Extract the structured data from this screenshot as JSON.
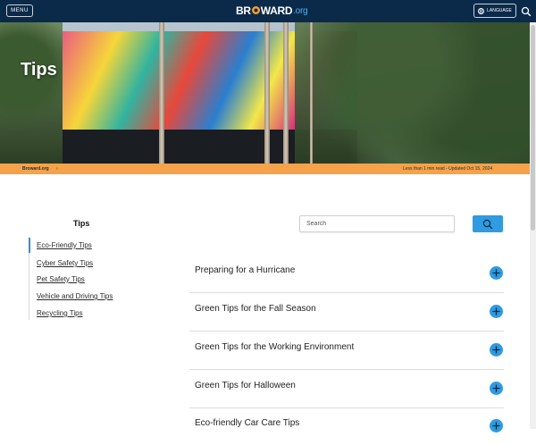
{
  "header": {
    "menu_label": "MENU",
    "logo_text_a": "BR",
    "logo_text_b": "WARD",
    "logo_text_c": ".org",
    "language_label": "LANGUAGE",
    "search_icon": "search-icon",
    "colors": {
      "bar": "#0b2a4a",
      "accent_orange": "#f9a12b",
      "accent_blue": "#4fb3e8"
    }
  },
  "hero": {
    "title": "Tips"
  },
  "breadcrumb": {
    "items": [
      "Broward.org"
    ],
    "separator": "›",
    "read_time": "Less than 1 min read - Updated Oct 15, 2024",
    "color": "#f5a24a"
  },
  "sidebar": {
    "title": "Tips",
    "items": [
      {
        "label": "Eco-Friendly Tips",
        "active": true
      },
      {
        "label": "Cyber Safety Tips",
        "active": false
      },
      {
        "label": "Pet Safety Tips",
        "active": false
      },
      {
        "label": "Vehicle and Driving Tips",
        "active": false
      },
      {
        "label": "Recycling Tips",
        "active": false
      }
    ]
  },
  "search": {
    "placeholder": "Search",
    "button_icon": "search-icon",
    "button_color": "#2f9be0"
  },
  "accordion": {
    "items": [
      {
        "title": "Preparing for a Hurricane",
        "icon": "plus-icon"
      },
      {
        "title": "Green Tips for the Fall Season",
        "icon": "plus-icon"
      },
      {
        "title": "Green Tips for the Working Environment",
        "icon": "plus-icon"
      },
      {
        "title": "Green Tips for Halloween",
        "icon": "plus-icon"
      },
      {
        "title": "Eco-friendly Car Care Tips",
        "icon": "plus-icon"
      }
    ]
  }
}
